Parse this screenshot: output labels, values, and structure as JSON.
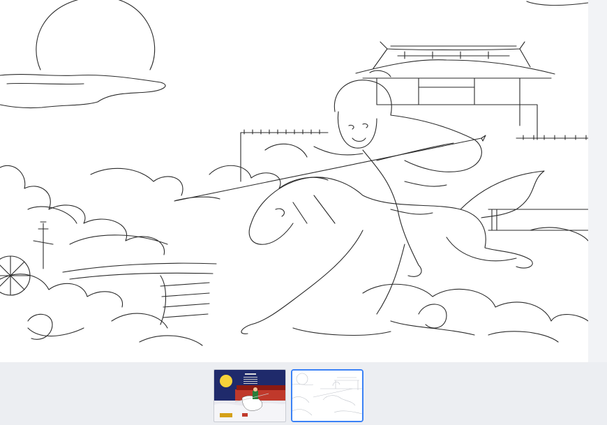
{
  "viewer": {
    "title": "",
    "selected_index": 1
  },
  "main_image": {
    "icon": "line-art-coloring-page",
    "subject": "mounted-warrior-with-spear-illustration"
  },
  "thumbnails": [
    {
      "icon": "colored-illustration-thumbnail",
      "selected": false
    },
    {
      "icon": "line-art-thumbnail",
      "selected": true
    }
  ],
  "colors": {
    "background": "#eceef2",
    "selection_border": "#3b82f6",
    "line_art": "#222222"
  }
}
